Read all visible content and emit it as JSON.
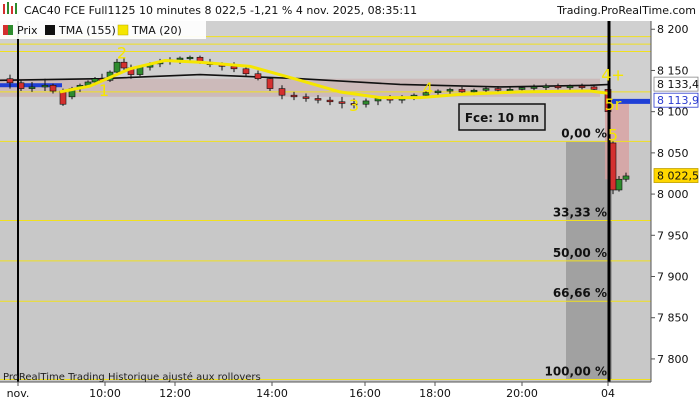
{
  "header": {
    "title": "CAC40 FCE Full1125 10 minutes 8 022,5 -1,21 % 4 nov. 2025, 08:35:11",
    "source": "Trading.ProRealTime.com"
  },
  "legend": [
    {
      "label": "Prix",
      "color": "#d4302f",
      "color2": "#2e8b2e"
    },
    {
      "label": "TMA (155)",
      "color": "#111111"
    },
    {
      "label": "TMA (20)",
      "color": "#f5e600"
    }
  ],
  "footer": {
    "note": "ProRealTime Trading  Historique ajusté aux rollovers"
  },
  "annotation": {
    "box_label": "Fce: 10 mn"
  },
  "colors": {
    "plot_bg": "#c8c8c8",
    "yellow": "#f5e600",
    "hline": "#f0e020",
    "blue": "#1f3fd6",
    "candle_up": "#2e8b2e",
    "candle_down": "#d4302f",
    "fib_zone": "#9a9a9a",
    "pink_zone": "#d8a0a0",
    "price_tag": "#ffd700"
  },
  "chart_data": {
    "type": "candlestick",
    "title": "CAC40 FCE Full1125 10 minutes",
    "x_ticks": [
      "nov.",
      "10:00",
      "12:00",
      "14:00",
      "16:00",
      "18:00",
      "20:00",
      "04"
    ],
    "y_ticks": [
      "8 200",
      "8 150",
      "8 100",
      "8 050",
      "8 000",
      "7 950",
      "7 900",
      "7 850",
      "7 800"
    ],
    "ylim": [
      7772,
      8210
    ],
    "last_price": "8 022,5",
    "price_labels": [
      {
        "text": "8 133,4",
        "value": 8133.4
      },
      {
        "text": "8 113,9",
        "value": 8113.9
      },
      {
        "text": "8 022,5",
        "value": 8022.5
      }
    ],
    "horizontal_levels": [
      8191,
      8182,
      8173,
      8124,
      8064,
      7968,
      7919,
      7870,
      7775
    ],
    "fib_levels": [
      {
        "label": "0,00 %",
        "value": 8064
      },
      {
        "label": "33,33 %",
        "value": 7968
      },
      {
        "label": "50,00 %",
        "value": 7919
      },
      {
        "label": "66,66 %",
        "value": 7870
      },
      {
        "label": "100,00 %",
        "value": 7775
      }
    ],
    "wave_labels": [
      {
        "text": "1",
        "t": 104,
        "p": 8126
      },
      {
        "text": "2",
        "t": 122,
        "p": 8172
      },
      {
        "text": "3",
        "t": 354,
        "p": 8108
      },
      {
        "text": "4",
        "t": 428,
        "p": 8129
      },
      {
        "text": "4+",
        "t": 613,
        "p": 8145
      },
      {
        "text": "5r",
        "t": 613,
        "p": 8109
      },
      {
        "text": "5",
        "t": 613,
        "p": 8072
      }
    ],
    "candles": [
      [
        10,
        8140,
        8145,
        8128,
        8135
      ],
      [
        21,
        8135,
        8138,
        8125,
        8128
      ],
      [
        32,
        8128,
        8136,
        8124,
        8130
      ],
      [
        45,
        8130,
        8140,
        8125,
        8132
      ],
      [
        53,
        8132,
        8134,
        8122,
        8125
      ],
      [
        63,
        8125,
        8128,
        8107,
        8109
      ],
      [
        72,
        8118,
        8130,
        8115,
        8128
      ],
      [
        80,
        8128,
        8134,
        8124,
        8132
      ],
      [
        88,
        8132,
        8138,
        8130,
        8136
      ],
      [
        95,
        8136,
        8142,
        8132,
        8140
      ],
      [
        102,
        8140,
        8146,
        8136,
        8138
      ],
      [
        110,
        8138,
        8150,
        8136,
        8148
      ],
      [
        117,
        8148,
        8164,
        8144,
        8160
      ],
      [
        124,
        8160,
        8166,
        8150,
        8153
      ],
      [
        131,
        8153,
        8157,
        8140,
        8145
      ],
      [
        140,
        8145,
        8156,
        8143,
        8154
      ],
      [
        150,
        8154,
        8160,
        8150,
        8158
      ],
      [
        160,
        8158,
        8164,
        8154,
        8161
      ],
      [
        170,
        8161,
        8166,
        8157,
        8163
      ],
      [
        180,
        8163,
        8167,
        8158,
        8165
      ],
      [
        190,
        8165,
        8168,
        8160,
        8166
      ],
      [
        200,
        8166,
        8168,
        8158,
        8160
      ],
      [
        210,
        8160,
        8164,
        8154,
        8157
      ],
      [
        222,
        8157,
        8160,
        8150,
        8155
      ],
      [
        234,
        8155,
        8160,
        8148,
        8152
      ],
      [
        246,
        8152,
        8155,
        8143,
        8146
      ],
      [
        258,
        8146,
        8150,
        8138,
        8140
      ],
      [
        270,
        8140,
        8142,
        8125,
        8128
      ],
      [
        282,
        8128,
        8132,
        8115,
        8120
      ],
      [
        294,
        8120,
        8124,
        8114,
        8118
      ],
      [
        306,
        8118,
        8122,
        8112,
        8116
      ],
      [
        318,
        8116,
        8120,
        8110,
        8114
      ],
      [
        330,
        8114,
        8118,
        8108,
        8112
      ],
      [
        342,
        8112,
        8118,
        8104,
        8110
      ],
      [
        354,
        8110,
        8116,
        8104,
        8109
      ],
      [
        366,
        8109,
        8116,
        8105,
        8113
      ],
      [
        378,
        8113,
        8118,
        8108,
        8116
      ],
      [
        390,
        8116,
        8120,
        8110,
        8114
      ],
      [
        402,
        8114,
        8120,
        8110,
        8118
      ],
      [
        414,
        8118,
        8122,
        8114,
        8120
      ],
      [
        426,
        8120,
        8126,
        8117,
        8123
      ],
      [
        438,
        8123,
        8127,
        8119,
        8125
      ],
      [
        450,
        8125,
        8129,
        8121,
        8127
      ],
      [
        462,
        8127,
        8130,
        8122,
        8124
      ],
      [
        474,
        8124,
        8128,
        8120,
        8126
      ],
      [
        486,
        8126,
        8130,
        8122,
        8128
      ],
      [
        498,
        8128,
        8131,
        8124,
        8126
      ],
      [
        510,
        8126,
        8130,
        8122,
        8127
      ],
      [
        522,
        8127,
        8131,
        8123,
        8129
      ],
      [
        534,
        8129,
        8133,
        8125,
        8130
      ],
      [
        546,
        8130,
        8134,
        8126,
        8131
      ],
      [
        558,
        8131,
        8134,
        8127,
        8129
      ],
      [
        570,
        8129,
        8133,
        8125,
        8131
      ],
      [
        582,
        8131,
        8134,
        8127,
        8130
      ],
      [
        594,
        8130,
        8133,
        8125,
        8127
      ],
      [
        608,
        8127,
        8129,
        8095,
        8100
      ],
      [
        613,
        8062,
        8064,
        8000,
        8005
      ],
      [
        619,
        8005,
        8022,
        8003,
        8018
      ],
      [
        626,
        8018,
        8026,
        8015,
        8022
      ]
    ],
    "tma_20": [
      [
        60,
        8124
      ],
      [
        90,
        8131
      ],
      [
        130,
        8152
      ],
      [
        165,
        8162
      ],
      [
        200,
        8160
      ],
      [
        250,
        8155
      ],
      [
        300,
        8138
      ],
      [
        340,
        8124
      ],
      [
        380,
        8117
      ],
      [
        420,
        8117
      ],
      [
        460,
        8121
      ],
      [
        520,
        8124
      ],
      [
        590,
        8125
      ],
      [
        610,
        8122
      ]
    ],
    "tma_155": [
      [
        0,
        8138
      ],
      [
        100,
        8140
      ],
      [
        200,
        8145
      ],
      [
        300,
        8140
      ],
      [
        400,
        8133
      ],
      [
        500,
        8130
      ],
      [
        590,
        8132
      ],
      [
        610,
        8133
      ]
    ]
  }
}
